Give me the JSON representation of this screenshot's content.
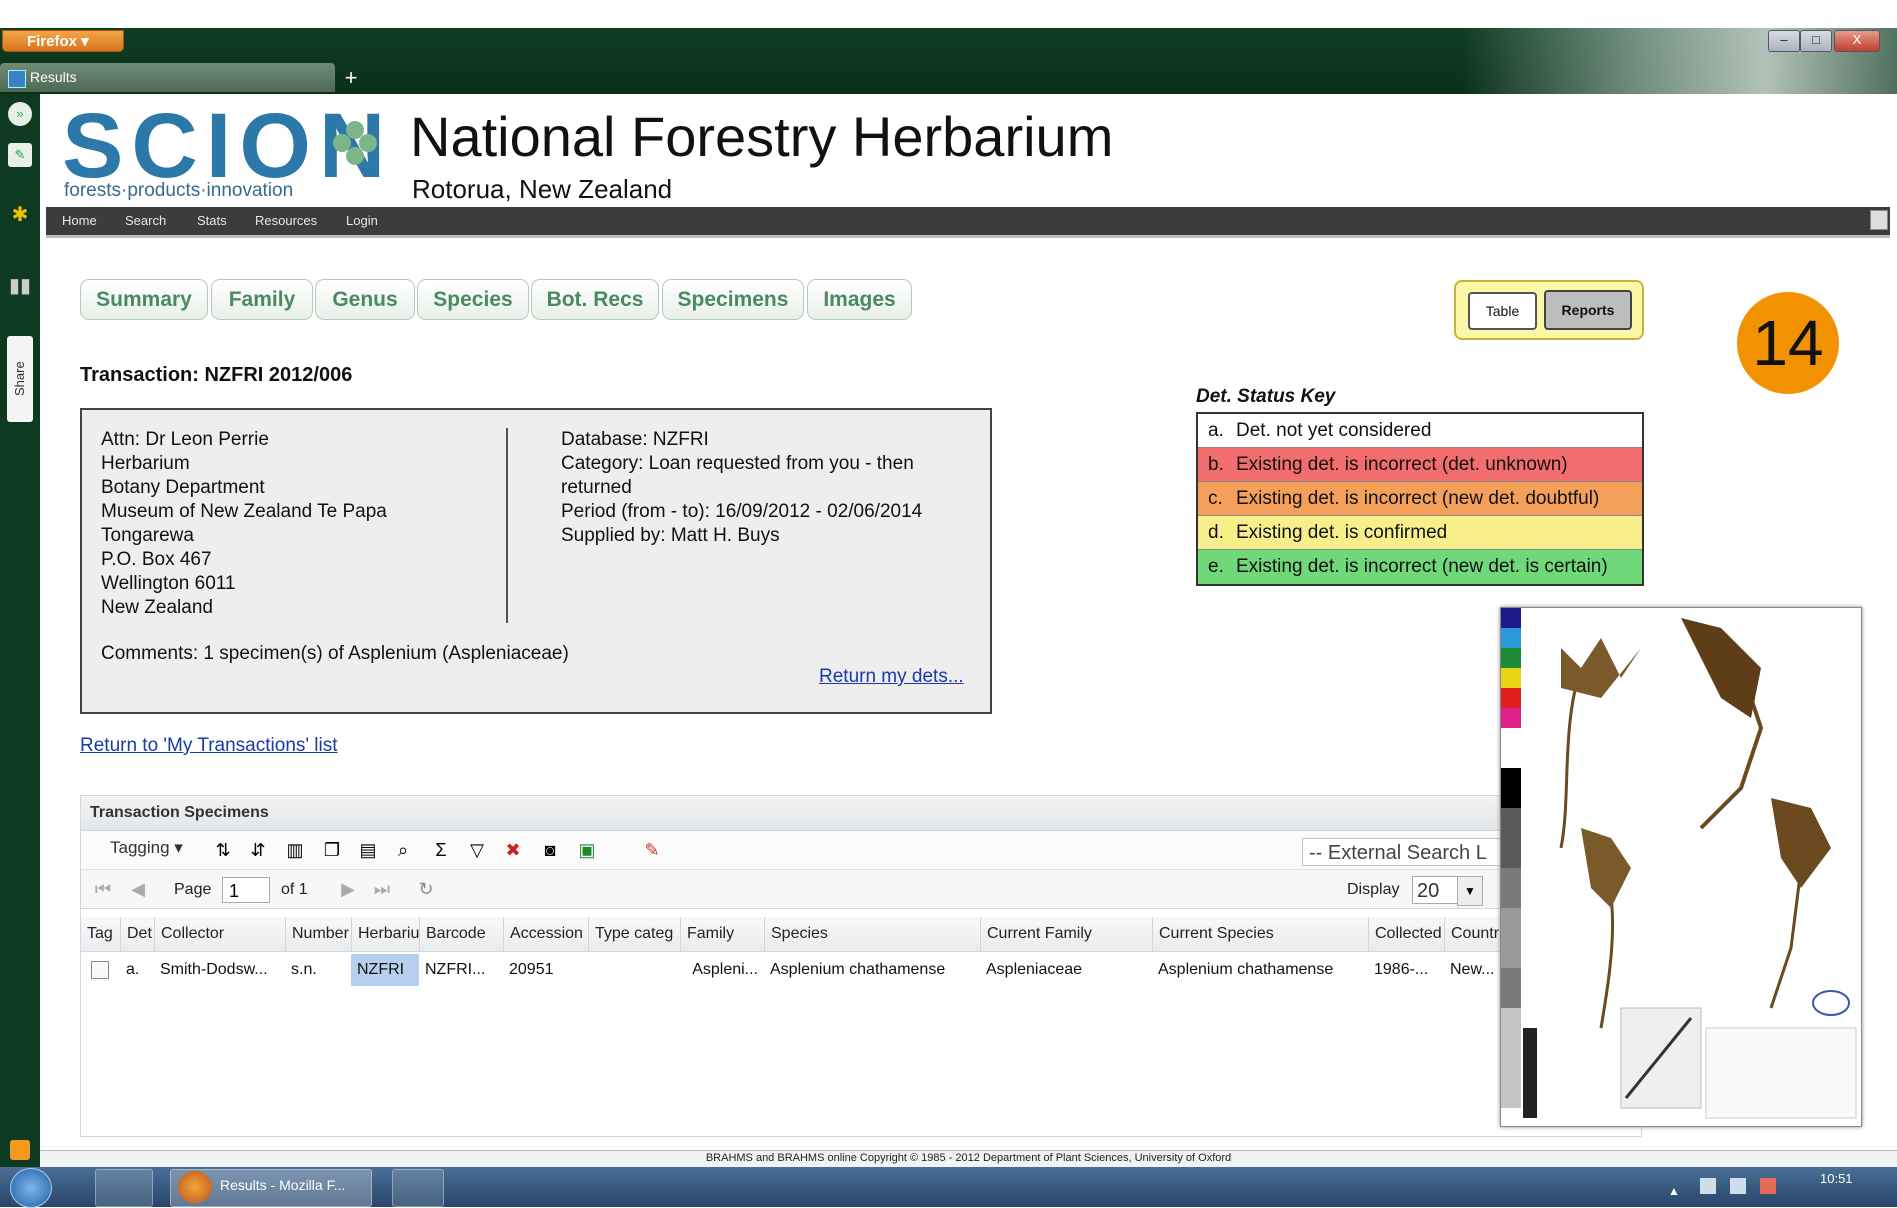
{
  "browser": {
    "menu_label": "Firefox",
    "tab_title": "Results",
    "new_tab": "+",
    "controls": {
      "minimize": "–",
      "restore": "□",
      "close": "X"
    }
  },
  "sidebar": {
    "share_label": "Share"
  },
  "site": {
    "logo_text": "SCION",
    "tagline": "forests·products·innovation",
    "title": "National Forestry Herbarium",
    "subtitle": "Rotorua, New Zealand"
  },
  "nav": {
    "items": [
      "Home",
      "Search",
      "Stats",
      "Resources",
      "Login"
    ]
  },
  "tabs": [
    "Summary",
    "Family",
    "Genus",
    "Species",
    "Bot. Recs",
    "Specimens",
    "Images"
  ],
  "view_toggle": {
    "table": "Table",
    "reports": "Reports"
  },
  "badge": "14",
  "transaction": {
    "title": "Transaction: NZFRI 2012/006",
    "address": [
      "Attn: Dr Leon Perrie",
      "Herbarium",
      "Botany Department",
      "Museum of New Zealand Te Papa",
      "Tongarewa",
      "P.O. Box 467",
      "Wellington 6011",
      "New Zealand"
    ],
    "details": [
      "Database: NZFRI",
      "Category: Loan requested from you - then",
      "returned",
      "Period (from - to): 16/09/2012 - 02/06/2014",
      "Supplied by: Matt H. Buys"
    ],
    "comments": "Comments: 1 specimen(s) of Asplenium (Aspleniaceae)",
    "return_dets": "Return my dets...",
    "return_list": "Return to 'My Transactions' list"
  },
  "det_key": {
    "title": "Det. Status Key",
    "rows": [
      {
        "k": "a.",
        "text": "Det. not yet considered",
        "color": "#ffffff"
      },
      {
        "k": "b.",
        "text": "Existing det. is incorrect (det. unknown)",
        "color": "#f26d6d"
      },
      {
        "k": "c.",
        "text": "Existing det. is incorrect (new det. doubtful)",
        "color": "#f5a05a"
      },
      {
        "k": "d.",
        "text": "Existing det. is confirmed",
        "color": "#f7f08a"
      },
      {
        "k": "e.",
        "text": "Existing det. is incorrect (new det. is certain)",
        "color": "#6fd97a"
      }
    ]
  },
  "grid": {
    "title": "Transaction Specimens",
    "tagging": "Tagging",
    "external_search": "-- External Search L",
    "page_label": "Page",
    "page_value": "1",
    "of_label": "of 1",
    "display_label": "Display",
    "display_value": "20",
    "columns": [
      "Tag",
      "Det",
      "Collector",
      "Number",
      "Herbariu",
      "Barcode",
      "Accession",
      "Type categ",
      "Family",
      "Species",
      "Current Family",
      "Current Species",
      "Collected",
      "Countr"
    ],
    "row": [
      "",
      "a.",
      "Smith-Dodsw...",
      "s.n.",
      "NZFRI",
      "NZFRI...",
      "20951",
      "",
      "Aspleni...",
      "Asplenium chathamense",
      "Aspleniaceae",
      "Asplenium chathamense",
      "1986-...",
      "New..."
    ]
  },
  "footer": "BRAHMS and BRAHMS online Copyright © 1985 - 2012 Department of Plant Sciences, University of Oxford",
  "taskbar": {
    "task_label": "Results - Mozilla F...",
    "clock": "10:51"
  }
}
